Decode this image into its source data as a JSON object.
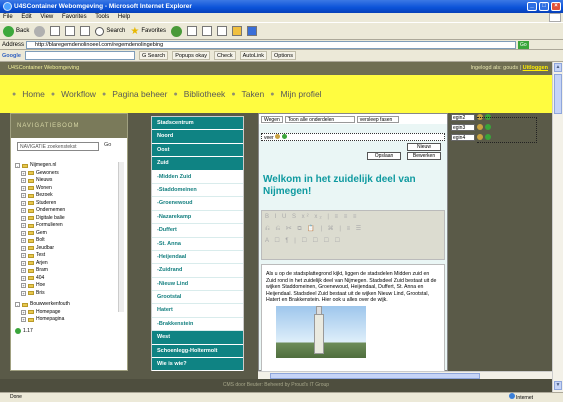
{
  "window": {
    "title": "U4SContainer Webomgeving - Microsoft Internet Explorer"
  },
  "menu": [
    "File",
    "Edit",
    "View",
    "Favorites",
    "Tools",
    "Help"
  ],
  "toolbar": {
    "back": "Back",
    "search": "Search",
    "favorites": "Favorites"
  },
  "address": {
    "label": "Address",
    "url": "http://blaregemdenolinoeel.com/regemdenolingebing",
    "go": "Go"
  },
  "google": {
    "label": "Google",
    "search_btn": "G Search",
    "popups": "Popups okay",
    "check": "Check",
    "autolink": "AutoLink",
    "options": "Options"
  },
  "site": {
    "header": "U4SContainer Webomgeving",
    "logged_in_prefix": "Ingelogd als: gouds | ",
    "logged_in_link": "Uitloggen",
    "nav": [
      "Home",
      "Workflow",
      "Pagina beheer",
      "Bibliotheek",
      "Taken",
      "Mijn profiel"
    ]
  },
  "leftpanel": {
    "title": "NAVIGATIEBOOM",
    "search_placeholder": "NAVIGATIE zoekenstekst",
    "go": "Go",
    "tree": [
      "Nijmegen.nl",
      "Gewoners",
      "Nieuws",
      "Wonen",
      "Bezoek",
      "Studeren",
      "Ondernemen",
      "Digitale balie",
      "Formulieren",
      "Gem",
      "Bolt",
      "Jeudbar",
      "Test",
      "Arjen",
      "Bram",
      "404",
      "Hoe",
      "Bris",
      "Bouwwerkenfouth",
      "Homepage",
      "Homepagina",
      "1.17"
    ]
  },
  "midnav": {
    "items": [
      {
        "label": "Stadscentrum",
        "style": "dark"
      },
      {
        "label": "Noord",
        "style": "dark"
      },
      {
        "label": "Oost",
        "style": "dark"
      },
      {
        "label": "Zuid",
        "style": "dark"
      },
      {
        "label": "-Midden Zuid",
        "style": "light"
      },
      {
        "label": "-Staddomeinen",
        "style": "light"
      },
      {
        "label": "-Groenewoud",
        "style": "light"
      },
      {
        "label": "-Nazarekamp",
        "style": "light"
      },
      {
        "label": "-Duffert",
        "style": "light"
      },
      {
        "label": "-St. Anna",
        "style": "light"
      },
      {
        "label": "-Heijendaal",
        "style": "light"
      },
      {
        "label": "-Zuidrand",
        "style": "light"
      },
      {
        "label": "-Nieuw Lind",
        "style": "light"
      },
      {
        "label": "Grootstal",
        "style": "light"
      },
      {
        "label": "Hatert",
        "style": "light"
      },
      {
        "label": "-Brakkenstein",
        "style": "light"
      },
      {
        "label": "West",
        "style": "dark"
      },
      {
        "label": "Schoenlegg-Holtermolt",
        "style": "dark"
      },
      {
        "label": "Wie is wie?",
        "style": "dark"
      }
    ]
  },
  "editor": {
    "sel1": "Wegen",
    "sel2": "Toon alle onderdelen",
    "sel3": "versleep fasen",
    "dotted_label": "veer",
    "btn_opslaan": "Opslaan",
    "btn_nieuw": "Nieuw",
    "btn_bekijk": "Bekijk",
    "btn_bewerken": "Bewerken",
    "heading": "Welkom in het zuidelijk deel van Nijmegen!",
    "toolbar_row1": "B I U S x² x₂ | ≡ ≡ ≡",
    "toolbar_row2": "⎌ ⎌ ✂ ⧉ 📋 | ⌘ | ≡ ☰",
    "toolbar_row3": "A ☐ ¶ | ☐ ☐ ☐ ☐",
    "body": "Als u op de stadsplattegrond kijkt, liggen de stadsdelen Midden zuid en Zuid rond in het zuidelijk deel van Nijmegen. Stadsdeel Zuid bestaat uit de wijken Staddomeinen, Groenewoud, Heijendaal, Duffert, St. Anna en Heijendaal. Stadsdeel Zuid bestaat uit de wijken Nieuw Lind, Grootstal, Hatert en Brakkenstein. Hier ook u alles over de wijk."
  },
  "rightpanel": {
    "rows": [
      "egin2",
      "egin3",
      "egin4"
    ]
  },
  "footer": "CMS door Beuter: Beheerd by Proud's IT Group",
  "status": {
    "left": "Done",
    "zone": "Internet"
  }
}
